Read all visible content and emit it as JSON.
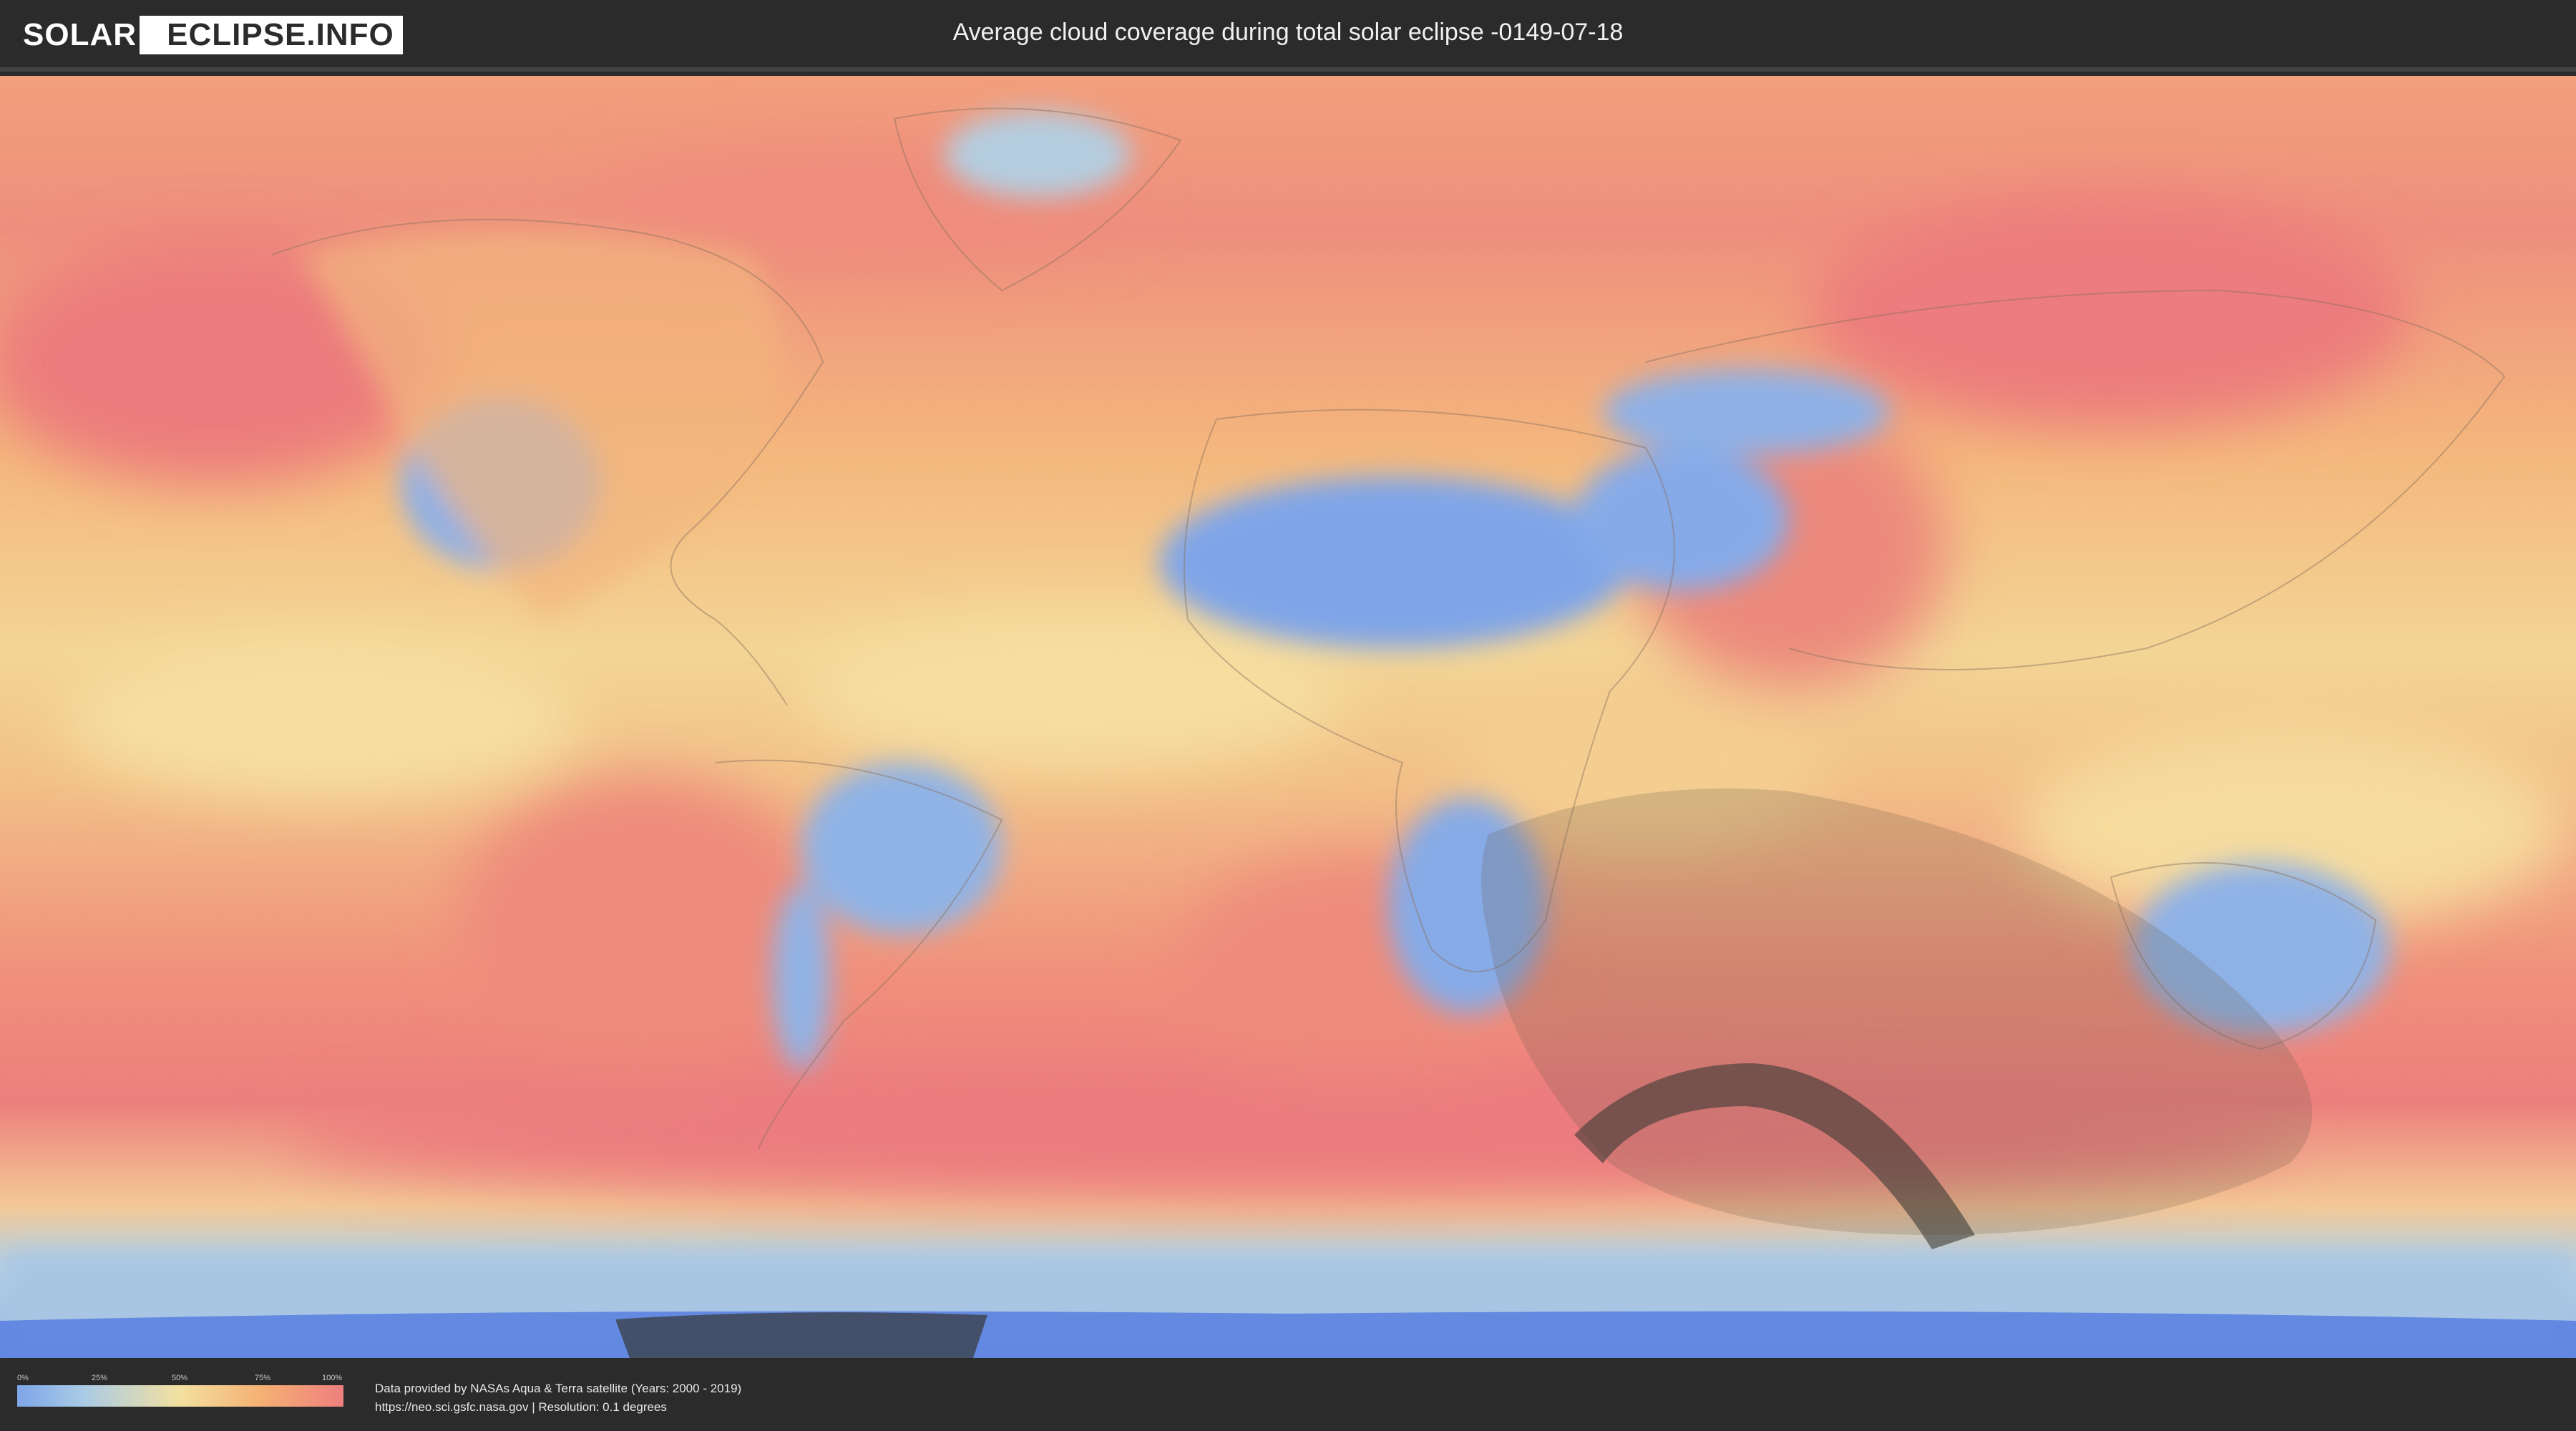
{
  "header": {
    "logo_part1": "SOLAR",
    "logo_part2": "ECLIPSE.INFO",
    "title": "Average cloud coverage during total solar eclipse -0149-07-18"
  },
  "map": {
    "description_icon": "world-map",
    "colors": {
      "clear": "#7ea5e8",
      "low": "#a9cbe6",
      "mid": "#f3e0a0",
      "high": "#f5b073",
      "overcast": "#ee7f7f",
      "eclipse_shadow": "#4a4a4a"
    }
  },
  "legend": {
    "ticks": [
      "0%",
      "25%",
      "50%",
      "75%",
      "100%"
    ]
  },
  "credits": {
    "line1": "Data provided by NASAs Aqua & Terra satellite (Years: 2000 - 2019)",
    "line2": "https://neo.sci.gsfc.nasa.gov | Resolution: 0.1 degrees"
  }
}
